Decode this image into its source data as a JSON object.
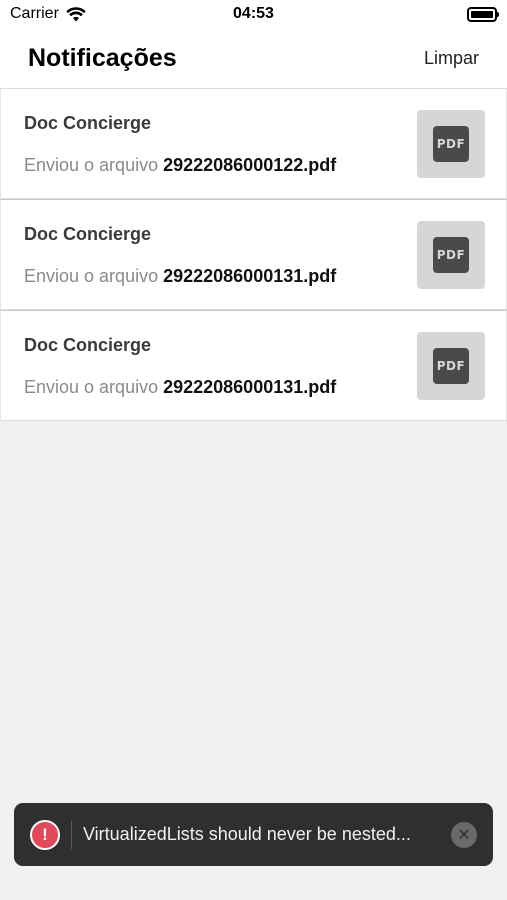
{
  "status_bar": {
    "carrier": "Carrier",
    "time": "04:53"
  },
  "header": {
    "title": "Notificações",
    "action_label": "Limpar"
  },
  "notifications": [
    {
      "sender": "Doc Concierge",
      "message": "Enviou o arquivo ",
      "file": "29222086000122.pdf",
      "thumb_label": "PDF"
    },
    {
      "sender": "Doc Concierge",
      "message": "Enviou o arquivo ",
      "file": "29222086000131.pdf",
      "thumb_label": "PDF"
    },
    {
      "sender": "Doc Concierge",
      "message": "Enviou o arquivo ",
      "file": "29222086000131.pdf",
      "thumb_label": "PDF"
    }
  ],
  "toast": {
    "alert_glyph": "!",
    "message": "VirtualizedLists should never be nested...",
    "close_glyph": "✕",
    "alert_color": "#e24a5b"
  }
}
